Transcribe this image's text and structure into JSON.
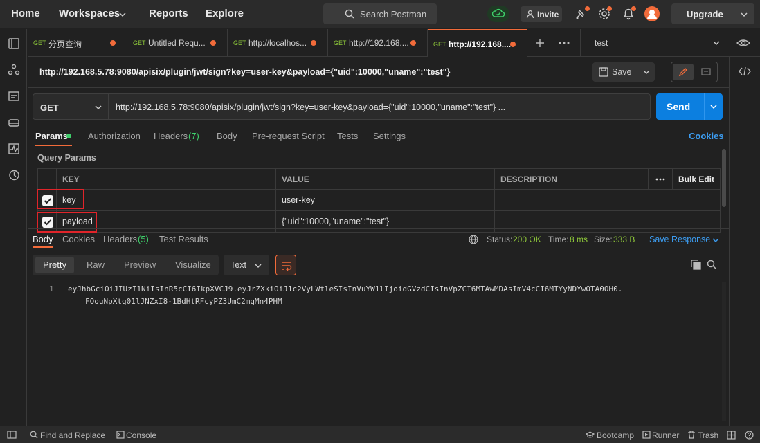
{
  "topbar": {
    "nav": [
      "Home",
      "Workspaces",
      "Reports",
      "Explore"
    ],
    "search_placeholder": "Search Postman",
    "invite_label": "Invite",
    "upgrade_label": "Upgrade"
  },
  "tabs": [
    {
      "method": "GET",
      "label": "分页查询"
    },
    {
      "method": "GET",
      "label": "Untitled Requ..."
    },
    {
      "method": "GET",
      "label": "http://localhos..."
    },
    {
      "method": "GET",
      "label": "http://192.168...."
    },
    {
      "method": "GET",
      "label": "http://192.168...."
    }
  ],
  "environment": "test",
  "request": {
    "title": "http://192.168.5.78:9080/apisix/plugin/jwt/sign?key=user-key&payload={\"uid\":10000,\"uname\":\"test\"}",
    "save_label": "Save",
    "method": "GET",
    "url": "http://192.168.5.78:9080/apisix/plugin/jwt/sign?key=user-key&payload={\"uid\":10000,\"uname\":\"test\"} ...",
    "send_label": "Send"
  },
  "request_tabs": {
    "params": "Params",
    "authorization": "Authorization",
    "headers": "Headers",
    "headers_count": "(7)",
    "body": "Body",
    "prerequest": "Pre-request Script",
    "tests": "Tests",
    "settings": "Settings",
    "cookies": "Cookies"
  },
  "query_params": {
    "title": "Query Params",
    "headers": {
      "key": "KEY",
      "value": "VALUE",
      "description": "DESCRIPTION",
      "bulk_edit": "Bulk Edit"
    },
    "rows": [
      {
        "key": "key",
        "value": "user-key",
        "description": ""
      },
      {
        "key": "payload",
        "value": "{\"uid\":10000,\"uname\":\"test\"}",
        "description": ""
      }
    ]
  },
  "response": {
    "tabs": {
      "body": "Body",
      "cookies": "Cookies",
      "headers": "Headers",
      "headers_count": "(5)",
      "test_results": "Test Results"
    },
    "status_label": "Status:",
    "status_value": "200 OK",
    "time_label": "Time:",
    "time_value": "8 ms",
    "size_label": "Size:",
    "size_value": "333 B",
    "save_response": "Save Response",
    "formats": [
      "Pretty",
      "Raw",
      "Preview",
      "Visualize"
    ],
    "text_type": "Text",
    "line_number": "1",
    "body_line1": "eyJhbGciOiJIUzI1NiIsInR5cCI6IkpXVCJ9.eyJrZXkiOiJ1c2VyLWtleSIsInVuYW1lIjoidGVzdCIsInVpZCI6MTAwMDAsImV4cCI6MTYyNDYwOTA0OH0.",
    "body_line2": "FOouNpXtg01lJNZxI8-1BdHtRFcyPZ3UmC2mgMn4PHM"
  },
  "statusbar": {
    "find_replace": "Find and Replace",
    "console": "Console",
    "bootcamp": "Bootcamp",
    "runner": "Runner",
    "trash": "Trash"
  },
  "colors": {
    "accent": "#f26b3a",
    "send": "#0c7fe0",
    "method_get": "#8fc93a",
    "highlight_box": "#e0242a"
  }
}
